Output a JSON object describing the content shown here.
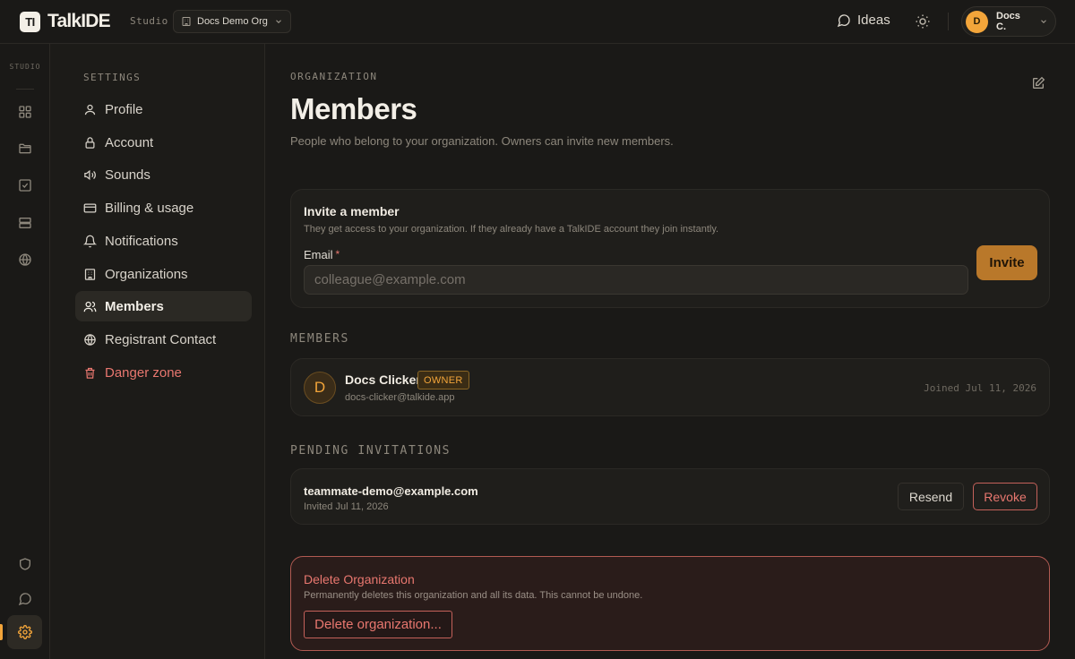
{
  "app": {
    "name": "TalkIDE",
    "logo_glyph": "TI",
    "context_label": "Studio",
    "org_selector": "Docs Demo Org"
  },
  "topbar": {
    "ideas_label": "Ideas",
    "user": {
      "initial": "D",
      "name": "Docs C."
    }
  },
  "rail": {
    "label": "STUDIO",
    "icons": [
      "grid-icon",
      "folder-icon",
      "checkbox-icon",
      "server-icon",
      "globe-icon",
      "shield-icon",
      "chat-icon",
      "gear-icon"
    ],
    "active": "gear-icon"
  },
  "settings_nav": {
    "heading": "SETTINGS",
    "items": [
      {
        "label": "Profile",
        "icon": "user-icon"
      },
      {
        "label": "Account",
        "icon": "lock-icon"
      },
      {
        "label": "Sounds",
        "icon": "speaker-icon"
      },
      {
        "label": "Billing & usage",
        "icon": "credit-card-icon"
      },
      {
        "label": "Notifications",
        "icon": "bell-icon"
      },
      {
        "label": "Organizations",
        "icon": "building-icon"
      },
      {
        "label": "Members",
        "icon": "users-icon",
        "active": true
      },
      {
        "label": "Registrant Contact",
        "icon": "globe-icon"
      },
      {
        "label": "Danger zone",
        "icon": "trash-icon",
        "danger": true
      }
    ]
  },
  "page": {
    "eyebrow": "ORGANIZATION",
    "title": "Members",
    "description": "People who belong to your organization. Owners can invite new members."
  },
  "invite": {
    "title": "Invite a member",
    "subtitle": "They get access to your organization. If they already have a TalkIDE account they join instantly.",
    "email_label": "Email",
    "required_mark": "*",
    "email_value": "",
    "email_placeholder": "colleague@example.com",
    "button": "Invite"
  },
  "members": {
    "heading": "MEMBERS",
    "list": [
      {
        "initial": "D",
        "name": "Docs Clicker",
        "badge": "OWNER",
        "email": "docs-clicker@talkide.app",
        "joined": "Joined Jul 11, 2026"
      }
    ]
  },
  "pending": {
    "heading": "PENDING INVITATIONS",
    "list": [
      {
        "email": "teammate-demo@example.com",
        "invited": "Invited Jul 11, 2026",
        "resend_label": "Resend",
        "revoke_label": "Revoke"
      }
    ]
  },
  "danger": {
    "title": "Delete Organization",
    "description": "Permanently deletes this organization and all its data. This cannot be undone.",
    "button": "Delete organization..."
  },
  "colors": {
    "background": "#1a1917",
    "accent": "#f3a53a",
    "danger": "#e8776f",
    "invite_button": "#b9782a"
  }
}
